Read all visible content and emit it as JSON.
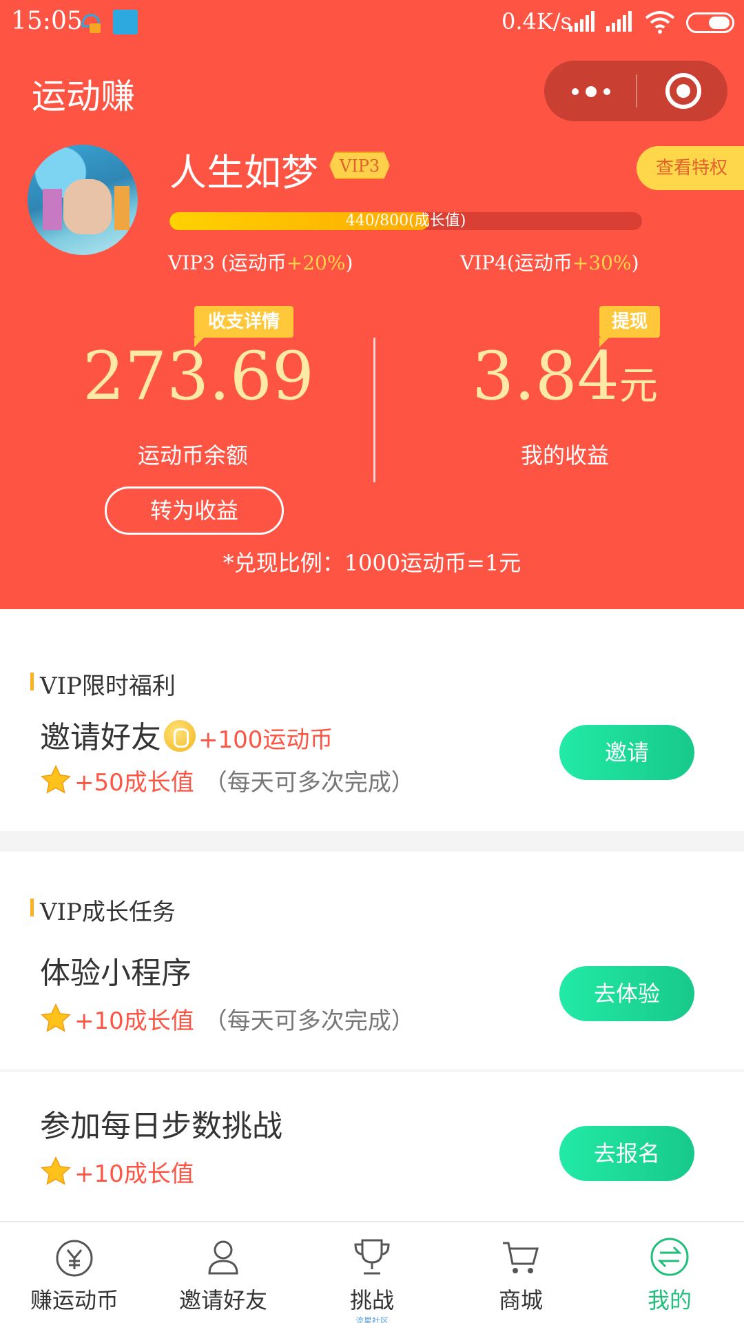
{
  "status_bar": {
    "time": "15:05",
    "speed": "0.4K/s"
  },
  "nav": {
    "title": "运动赚"
  },
  "profile": {
    "name": "人生如梦",
    "vip_badge": "VIP3",
    "privilege_button": "查看特权",
    "progress_text": "440/800(成长值)",
    "progress_fraction": 0.55,
    "vip_current_label": "VIP3 (运动币",
    "vip_current_bonus": "+20%",
    "vip_current_close": ")",
    "vip_next_label": "VIP4(运动币",
    "vip_next_bonus": "+30%",
    "vip_next_close": ")"
  },
  "wallet": {
    "details_tag": "收支详情",
    "withdraw_tag": "提现",
    "balance_value": "273.69",
    "balance_label": "运动币余额",
    "earnings_value": "3.84",
    "earnings_unit": "元",
    "earnings_label": "我的收益",
    "convert_button": "转为收益",
    "ratio_text": "*兑现比例：1000运动币=1元"
  },
  "vip_welfare": {
    "section_title": "VIP限时福利",
    "task_title": "邀请好友",
    "task_reward": "+100运动币",
    "growth": "+50成长值",
    "note": "（每天可多次完成）",
    "button": "邀请"
  },
  "vip_tasks": {
    "section_title": "VIP成长任务",
    "task1_title": "体验小程序",
    "task1_growth": "+10成长值",
    "task1_note": "（每天可多次完成）",
    "task1_button": "去体验",
    "task2_title": "参加每日步数挑战",
    "task2_growth": "+10成长值",
    "task2_button": "去报名"
  },
  "tabbar": {
    "tab1": "赚运动币",
    "tab2": "邀请好友",
    "tab3": "挑战",
    "tab3_watermark": "流星社区",
    "tab4": "商城",
    "tab5": "我的"
  },
  "colors": {
    "primary_red": "#fd5444",
    "accent_green": "#1fbf7b",
    "gold": "#ffd34a"
  }
}
